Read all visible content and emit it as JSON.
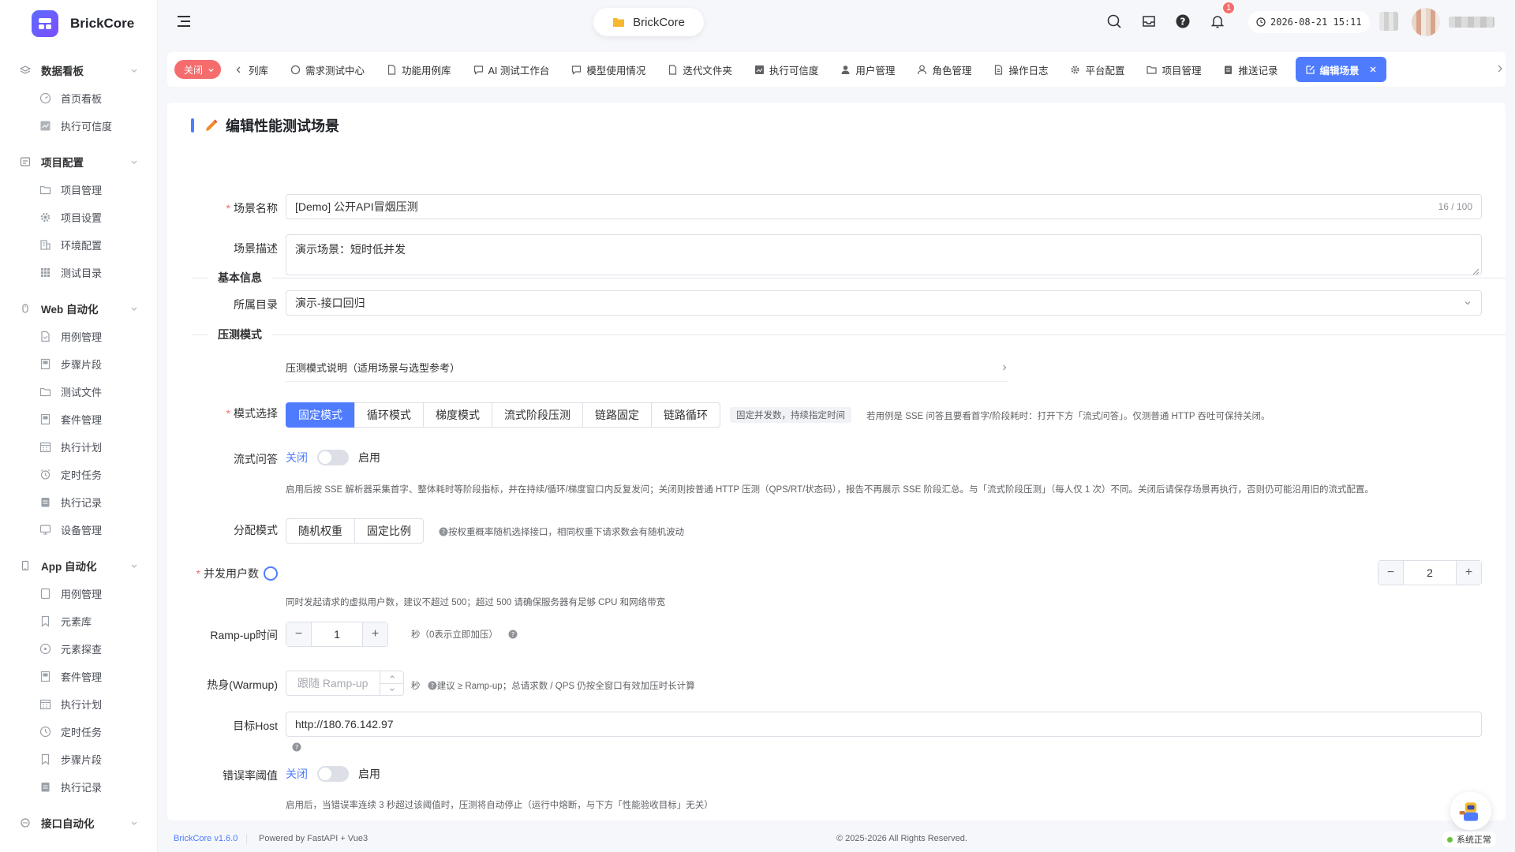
{
  "app": {
    "name": "BrickCore"
  },
  "sidebar": {
    "groups": [
      {
        "label": "数据看板",
        "items": [
          "首页看板",
          "执行可信度"
        ]
      },
      {
        "label": "项目配置",
        "items": [
          "项目管理",
          "项目设置",
          "环境配置",
          "测试目录"
        ]
      },
      {
        "label": "Web 自动化",
        "items": [
          "用例管理",
          "步骤片段",
          "测试文件",
          "套件管理",
          "执行计划",
          "定时任务",
          "执行记录",
          "设备管理"
        ]
      },
      {
        "label": "App 自动化",
        "items": [
          "用例管理",
          "元素库",
          "元素探查",
          "套件管理",
          "执行计划",
          "定时任务",
          "步骤片段",
          "执行记录"
        ]
      },
      {
        "label": "接口自动化",
        "items": []
      }
    ]
  },
  "topbar": {
    "project_pill": "BrickCore",
    "notification_count": "1",
    "datetime": "2026-08-21 15:11"
  },
  "tabs": {
    "close_label": "关闭",
    "items": [
      "列库",
      "需求测试中心",
      "功能用例库",
      "AI 测试工作台",
      "模型使用情况",
      "迭代文件夹",
      "执行可信度",
      "用户管理",
      "角色管理",
      "操作日志",
      "平台配置",
      "项目管理",
      "推送记录"
    ],
    "active": "编辑场景"
  },
  "page": {
    "title": "编辑性能测试场景",
    "section_basic": "基本信息",
    "section_mode": "压测模式",
    "name_label": "场景名称",
    "name_value": "[Demo] 公开API冒烟压测",
    "name_count": "16 / 100",
    "desc_label": "场景描述",
    "desc_value": "演示场景：短时低并发",
    "dir_label": "所属目录",
    "dir_value": "演示-接口回归",
    "mode_help": "压测模式说明（适用场景与选型参考）",
    "mode_label": "模式选择",
    "modes": [
      "固定模式",
      "循环模式",
      "梯度模式",
      "流式阶段压测",
      "链路固定",
      "链路循环"
    ],
    "mode_chip": "固定并发数，持续指定时间",
    "mode_hint": "若用例是 SSE 问答且要看首字/阶段耗时：打开下方「流式问答」。仅测普通 HTTP 吞吐可保持关闭。",
    "stream_label": "流式问答",
    "off": "关闭",
    "on": "启用",
    "stream_hint": "启用后按 SSE 解析器采集首字、整体耗时等阶段指标，并在持续/循环/梯度窗口内反复发问；关闭则按普通 HTTP 压测（QPS/RT/状态码），报告不再展示 SSE 阶段汇总。与「流式阶段压测」（每人仅 1 次）不同。关闭后请保存场景再执行，否则仍可能沿用旧的流式配置。",
    "dist_label": "分配模式",
    "dist_options": [
      "随机权重",
      "固定比例"
    ],
    "dist_hint": "按权重概率随机选择接口，相同权重下请求数会有随机波动",
    "users_label": "并发用户数",
    "users_value": "2",
    "users_hint": "同时发起请求的虚拟用户数，建议不超过 500；超过 500 请确保服务器有足够 CPU 和网络带宽",
    "ramp_label": "Ramp-up时间",
    "ramp_value": "1",
    "ramp_unit": "秒（0表示立即加压）",
    "warm_label": "热身(Warmup)",
    "warm_placeholder": "跟随 Ramp-up",
    "warm_unit": "秒",
    "warm_hint": "建议 ≥ Ramp-up；总请求数 / QPS 仍按全窗口有效加压时长计算",
    "host_label": "目标Host",
    "host_value": "http://180.76.142.97",
    "err_label": "错误率阈值",
    "err_hint": "启用后，当错误率连续 3 秒超过该阈值时，压测将自动停止（运行中熔断，与下方「性能验收目标」无关）"
  },
  "footer": {
    "version": "BrickCore v1.6.0",
    "powered": "Powered by FastAPI + Vue3",
    "copyright": "© 2025-2026 All Rights Reserved.",
    "status": "系统正常"
  },
  "colors": {
    "primary": "#4f7cff",
    "danger": "#f56c6c",
    "success": "#67c23a"
  }
}
